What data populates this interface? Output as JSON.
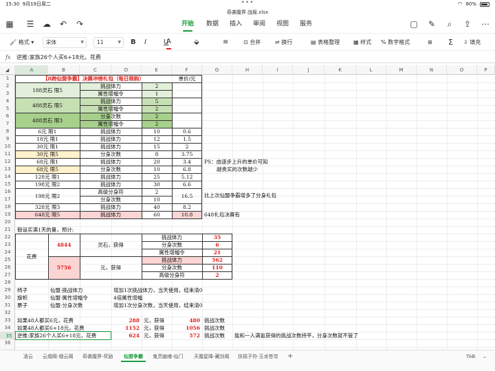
{
  "status": {
    "time": "15:30",
    "date": "9月19日周二",
    "dots": "•••",
    "wifi": "wifi-icon",
    "battery": "80%"
  },
  "file": {
    "name": "奇袭魔界 战报.xlsx"
  },
  "menu": {
    "tabs": [
      "开始",
      "数据",
      "插入",
      "审阅",
      "视图",
      "服务"
    ],
    "active": 0
  },
  "toolbar": {
    "format": "格式",
    "font": "宋体",
    "size": "11",
    "bold": "B",
    "italic": "I",
    "underline": "U",
    "fontcolor": "A",
    "merge": "合并",
    "wrap": "换行",
    "table": "表格整理",
    "style": "样式",
    "numfmt": "数字格式",
    "fill": "填充",
    "sum": "Σ"
  },
  "formula": {
    "fx": "fx",
    "value": "逆推:家族26个人买6+18元，花费"
  },
  "columns": [
    "A",
    "B",
    "C",
    "D",
    "E",
    "F",
    "G",
    "H",
    "I",
    "J",
    "K",
    "L",
    "M",
    "N",
    "O",
    "P"
  ],
  "rows": [
    "1",
    "2",
    "3",
    "4",
    "5",
    "6",
    "7",
    "8",
    "9",
    "10",
    "11",
    "12",
    "13",
    "14",
    "15",
    "16",
    "17",
    "18",
    "19",
    "20",
    "21",
    "22",
    "23",
    "24",
    "25",
    "26",
    "27",
    "28",
    "29",
    "30",
    "31",
    "32",
    "33",
    "34",
    "35",
    "36"
  ],
  "cells": {
    "r1_title": "【8跨仙盟争霸】决赛冲榜礼包（每日限购）",
    "r1_unit": "单价/元",
    "r2_a": "188灵石 限5",
    "r2_c": "挑战体力",
    "r2_e": "2",
    "r3_c": "属性增幅令",
    "r3_e": "1",
    "r4_a": "488灵石 限5",
    "r4_c": "挑战体力",
    "r4_e": "5",
    "r5_c": "属性增幅令",
    "r5_e": "2",
    "r6_a": "488灵石 限3",
    "r6_c": "分身次数",
    "r6_e": "2",
    "r7_c": "属性增幅令",
    "r7_e": "2",
    "r8_a": "6元 限1",
    "r8_c": "挑战体力",
    "r8_e": "10",
    "r8_f": "0.6",
    "r9_a": "18元 限1",
    "r9_c": "挑战体力",
    "r9_e": "12",
    "r9_f": "1.5",
    "r10_a": "30元 限1",
    "r10_c": "挑战体力",
    "r10_e": "15",
    "r10_f": "2",
    "r11_a": "30元 限5",
    "r11_c": "分身次数",
    "r11_e": "8",
    "r11_f": "3.75",
    "r12_a": "68元 限1",
    "r12_c": "挑战体力",
    "r12_e": "20",
    "r12_f": "3.4",
    "r12_g": "PS：由逐步上升的单价可知",
    "r13_a": "68元 限5",
    "r13_c": "分身次数",
    "r13_e": "10",
    "r13_f": "6.8",
    "r13_g": "越贵买的次数越少",
    "r14_a": "128元 限1",
    "r14_c": "挑战体力",
    "r14_e": "25",
    "r14_f": "5.12",
    "r15_a": "198元 限2",
    "r15_c": "挑战体力",
    "r15_e": "30",
    "r15_f": "6.6",
    "r16_a": "198元 限2",
    "r16_c1": "高级分身符",
    "r16_e1": "2",
    "r16_c2": "分身次数",
    "r16_e2": "10",
    "r16_f": "16.5",
    "r16_g": "比上次仙盟争霸增多了分身礼包",
    "r18_a": "328元 限3",
    "r18_c": "挑战体力",
    "r18_e": "40",
    "r18_f": "8.2",
    "r19_a": "648元 限5",
    "r19_c": "挑战体力",
    "r19_e": "60",
    "r19_f": "10.8",
    "r19_g": "648礼包决赛有",
    "r21": "假设买满1天的量，预计:",
    "r22_label": "花费",
    "r22_a": "4844",
    "r22_c": "灵石，获得",
    "r22_e1": "挑战体力",
    "r22_f1": "35",
    "r22_e2": "分身次数",
    "r22_f2": "6",
    "r22_e3": "属性增幅令",
    "r22_f3": "21",
    "r25_a": "5756",
    "r25_c": "元，获得",
    "r25_e1": "挑战体力",
    "r25_f1": "562",
    "r25_e2": "分身次数",
    "r25_f2": "110",
    "r25_e3": "高级分身符",
    "r25_f3": "2",
    "r29_a": "椅子",
    "r29_b": "仙盟·挑战体力",
    "r29_d": "增加1次挑战体力，当天使用，结束清0",
    "r30_a": "旗帜",
    "r30_b": "仙盟·属性增幅令",
    "r30_d": "4倍属性增幅",
    "r31_a": "票子",
    "r31_b": "仙盟·分身次数",
    "r31_d": "增加1次分身次数，当天使用，结束清0",
    "r33_a": "如果48人都买6元，花费",
    "r33_d": "288",
    "r33_e": "元，获得",
    "r33_f": "480",
    "r33_g": "挑战次数",
    "r34_a": "如果48人都买6+18元，花费",
    "r34_d": "1152",
    "r34_e": "元，获得",
    "r34_f": "1056",
    "r34_g": "挑战次数",
    "r35_a": "逆推:家族26个人买6+18元，花费",
    "r35_d": "624",
    "r35_e": "元，获得",
    "r35_f": "572",
    "r35_g": "挑战次数",
    "r35_h": "能和一人满氪获得的挑战次数持平，分身次数就不管了"
  },
  "sheets": {
    "tabs": [
      "凌云",
      "云烟阁-烟云阁",
      "奇袭魔界-奖励",
      "仙盟争霸",
      "鬼灵幽魂-仙门",
      "天魔星降-藏剑阁",
      "扶摇子符-玉龙苍穹"
    ],
    "active": 3,
    "tab_key": "TAB",
    "add": "+"
  },
  "colors": {
    "accent": "#1a9a3c",
    "green_fill": "#a8d08d",
    "light_green": "#e2efda",
    "yellow": "#fff2cc",
    "pink": "#fbd4d4",
    "red": "#e0201c"
  }
}
